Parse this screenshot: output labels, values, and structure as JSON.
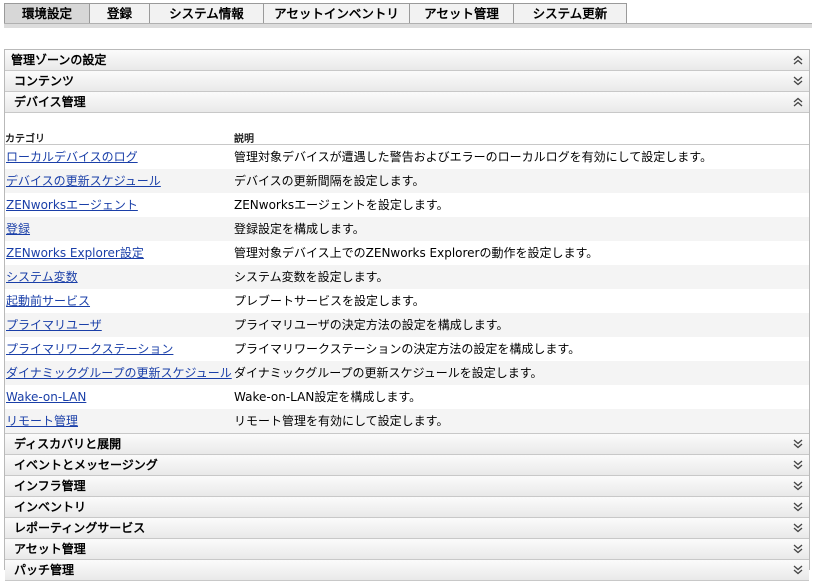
{
  "tabs": [
    {
      "label": "環境設定",
      "active": true
    },
    {
      "label": "登録",
      "active": false
    },
    {
      "label": "システム情報",
      "active": false
    },
    {
      "label": "アセットインベントリ",
      "active": false
    },
    {
      "label": "アセット管理",
      "active": false
    },
    {
      "label": "システム更新",
      "active": false
    }
  ],
  "panel": {
    "title": "管理ゾーンの設定",
    "title_state": "expanded",
    "sections_before": [
      {
        "label": "コンテンツ",
        "state": "collapsed"
      }
    ],
    "open_section": {
      "label": "デバイス管理",
      "state": "expanded",
      "col_category": "カテゴリ",
      "col_description": "説明",
      "rows": [
        {
          "category": "ローカルデバイスのログ",
          "description": "管理対象デバイスが遭遇した警告およびエラーのローカルログを有効にして設定します。"
        },
        {
          "category": "デバイスの更新スケジュール",
          "description": "デバイスの更新間隔を設定します。"
        },
        {
          "category": "ZENworksエージェント",
          "description": "ZENworksエージェントを設定します。"
        },
        {
          "category": "登録",
          "description": "登録設定を構成します。"
        },
        {
          "category": "ZENworks Explorer設定",
          "description": "管理対象デバイス上でのZENworks Explorerの動作を設定します。"
        },
        {
          "category": "システム変数",
          "description": "システム変数を設定します。"
        },
        {
          "category": "起動前サービス",
          "description": "プレブートサービスを設定します。"
        },
        {
          "category": "プライマリユーザ",
          "description": "プライマリユーザの決定方法の設定を構成します。"
        },
        {
          "category": "プライマリワークステーション",
          "description": "プライマリワークステーションの決定方法の設定を構成します。"
        },
        {
          "category": "ダイナミックグループの更新スケジュール",
          "description": "ダイナミックグループの更新スケジュールを設定します。"
        },
        {
          "category": "Wake-on-LAN",
          "description": "Wake-on-LAN設定を構成します。"
        },
        {
          "category": "リモート管理",
          "description": "リモート管理を有効にして設定します。"
        }
      ]
    },
    "sections_after": [
      {
        "label": "ディスカバリと展開",
        "state": "collapsed"
      },
      {
        "label": "イベントとメッセージング",
        "state": "collapsed"
      },
      {
        "label": "インフラ管理",
        "state": "collapsed"
      },
      {
        "label": "インベントリ",
        "state": "collapsed"
      },
      {
        "label": "レポーティングサービス",
        "state": "collapsed"
      },
      {
        "label": "アセット管理",
        "state": "collapsed"
      },
      {
        "label": "パッチ管理",
        "state": "collapsed"
      }
    ]
  },
  "icons": {
    "expanded": "chevron-double-up-icon",
    "collapsed": "chevron-double-down-icon"
  },
  "colors": {
    "link": "#1a3fa8",
    "tab_active": "#d7d7d7",
    "tab_inactive": "#f2f2f2"
  }
}
